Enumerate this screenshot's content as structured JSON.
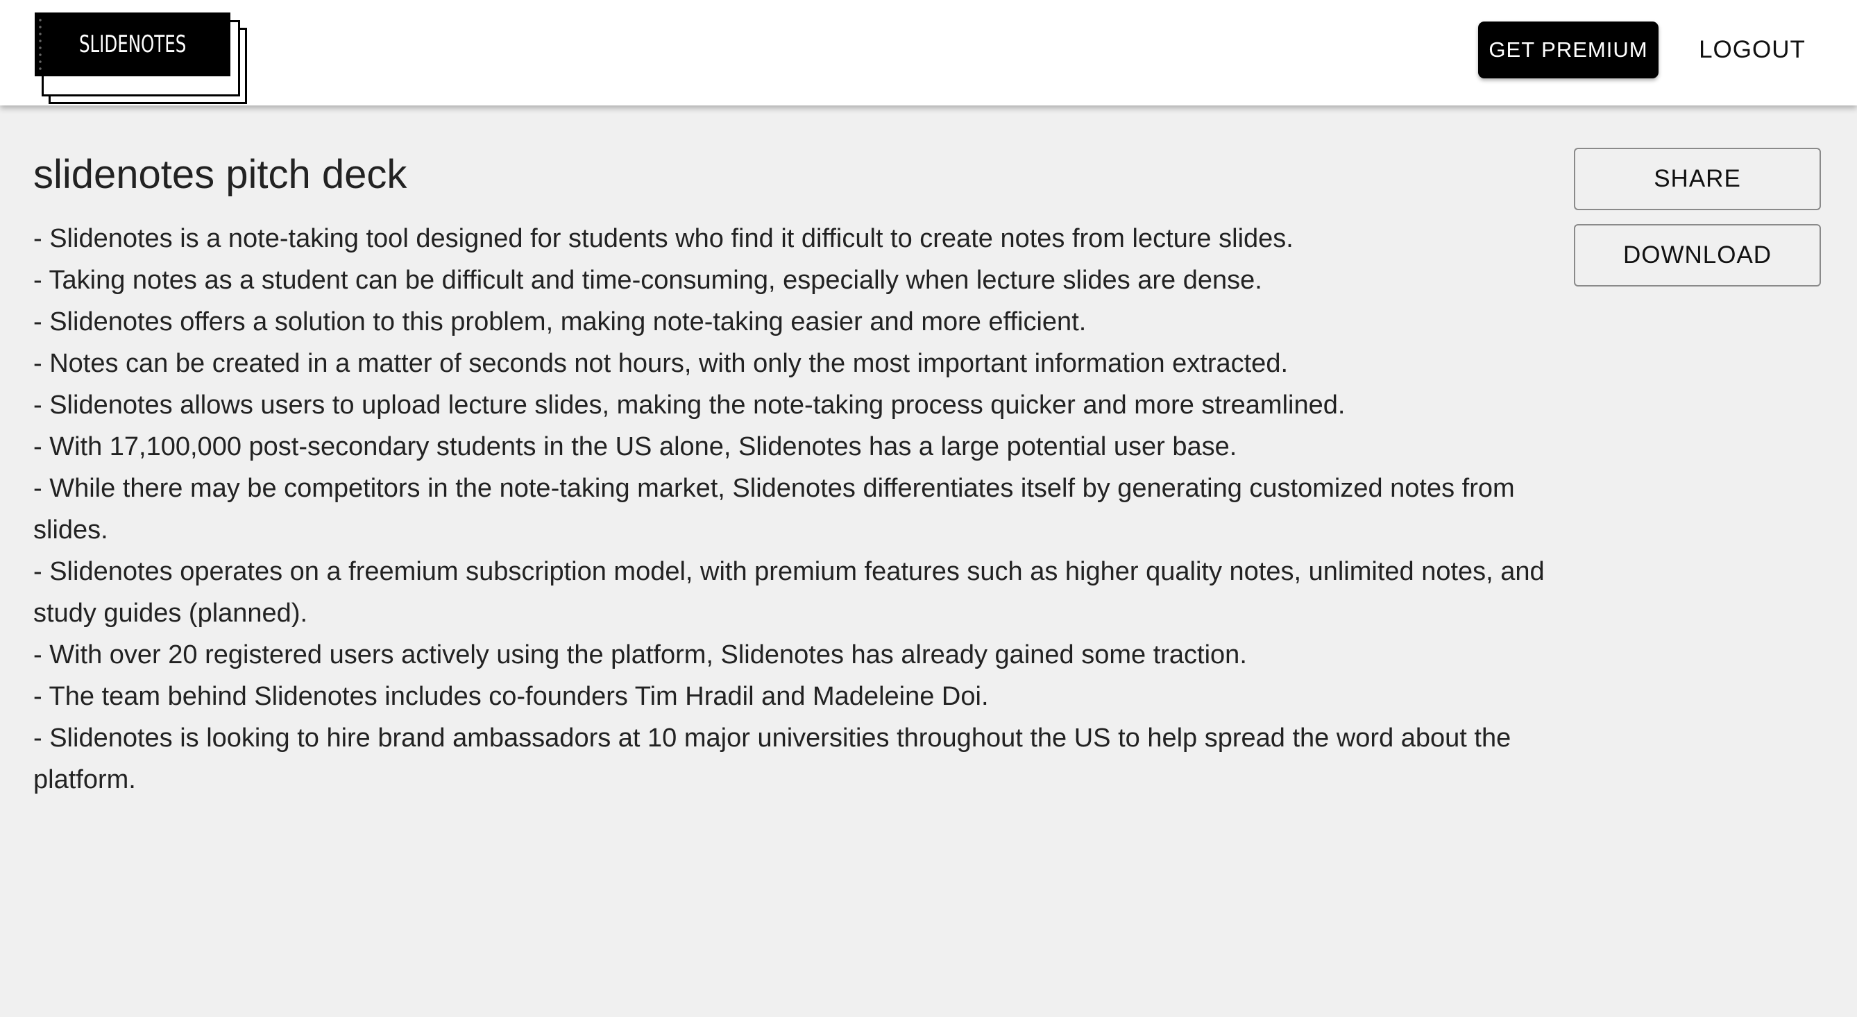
{
  "header": {
    "logo_text": "SLIDENOTES",
    "premium_label": "GET PREMIUM",
    "logout_label": "LOGOUT"
  },
  "document": {
    "title": "slidenotes pitch deck",
    "notes": [
      "- Slidenotes is a note-taking tool designed for students who find it difficult to create notes from lecture slides.",
      "- Taking notes as a student can be difficult and time-consuming, especially when lecture slides are dense.",
      "- Slidenotes offers a solution to this problem, making note-taking easier and more efficient.",
      "- Notes can be created in a matter of seconds not hours, with only the most important information extracted.",
      "- Slidenotes allows users to upload lecture slides, making the note-taking process quicker and more streamlined.",
      "- With 17,100,000 post-secondary students in the US alone, Slidenotes has a large potential user base.",
      "- While there may be competitors in the note-taking market, Slidenotes differentiates itself by generating customized notes from slides.",
      "- Slidenotes operates on a freemium subscription model, with premium features such as higher quality notes, unlimited notes, and study guides (planned).",
      "- With over 20 registered users actively using the platform, Slidenotes has already gained some traction.",
      "- The team behind Slidenotes includes co-founders Tim Hradil and Madeleine Doi.",
      "- Slidenotes is looking to hire brand ambassadors at 10 major universities throughout the US to help spread the word about the platform."
    ]
  },
  "actions": {
    "share_label": "SHARE",
    "download_label": "DOWNLOAD"
  },
  "colors": {
    "background": "#f0f0f0",
    "header_background": "#ffffff",
    "primary_button": "#000000",
    "text": "#222222"
  }
}
